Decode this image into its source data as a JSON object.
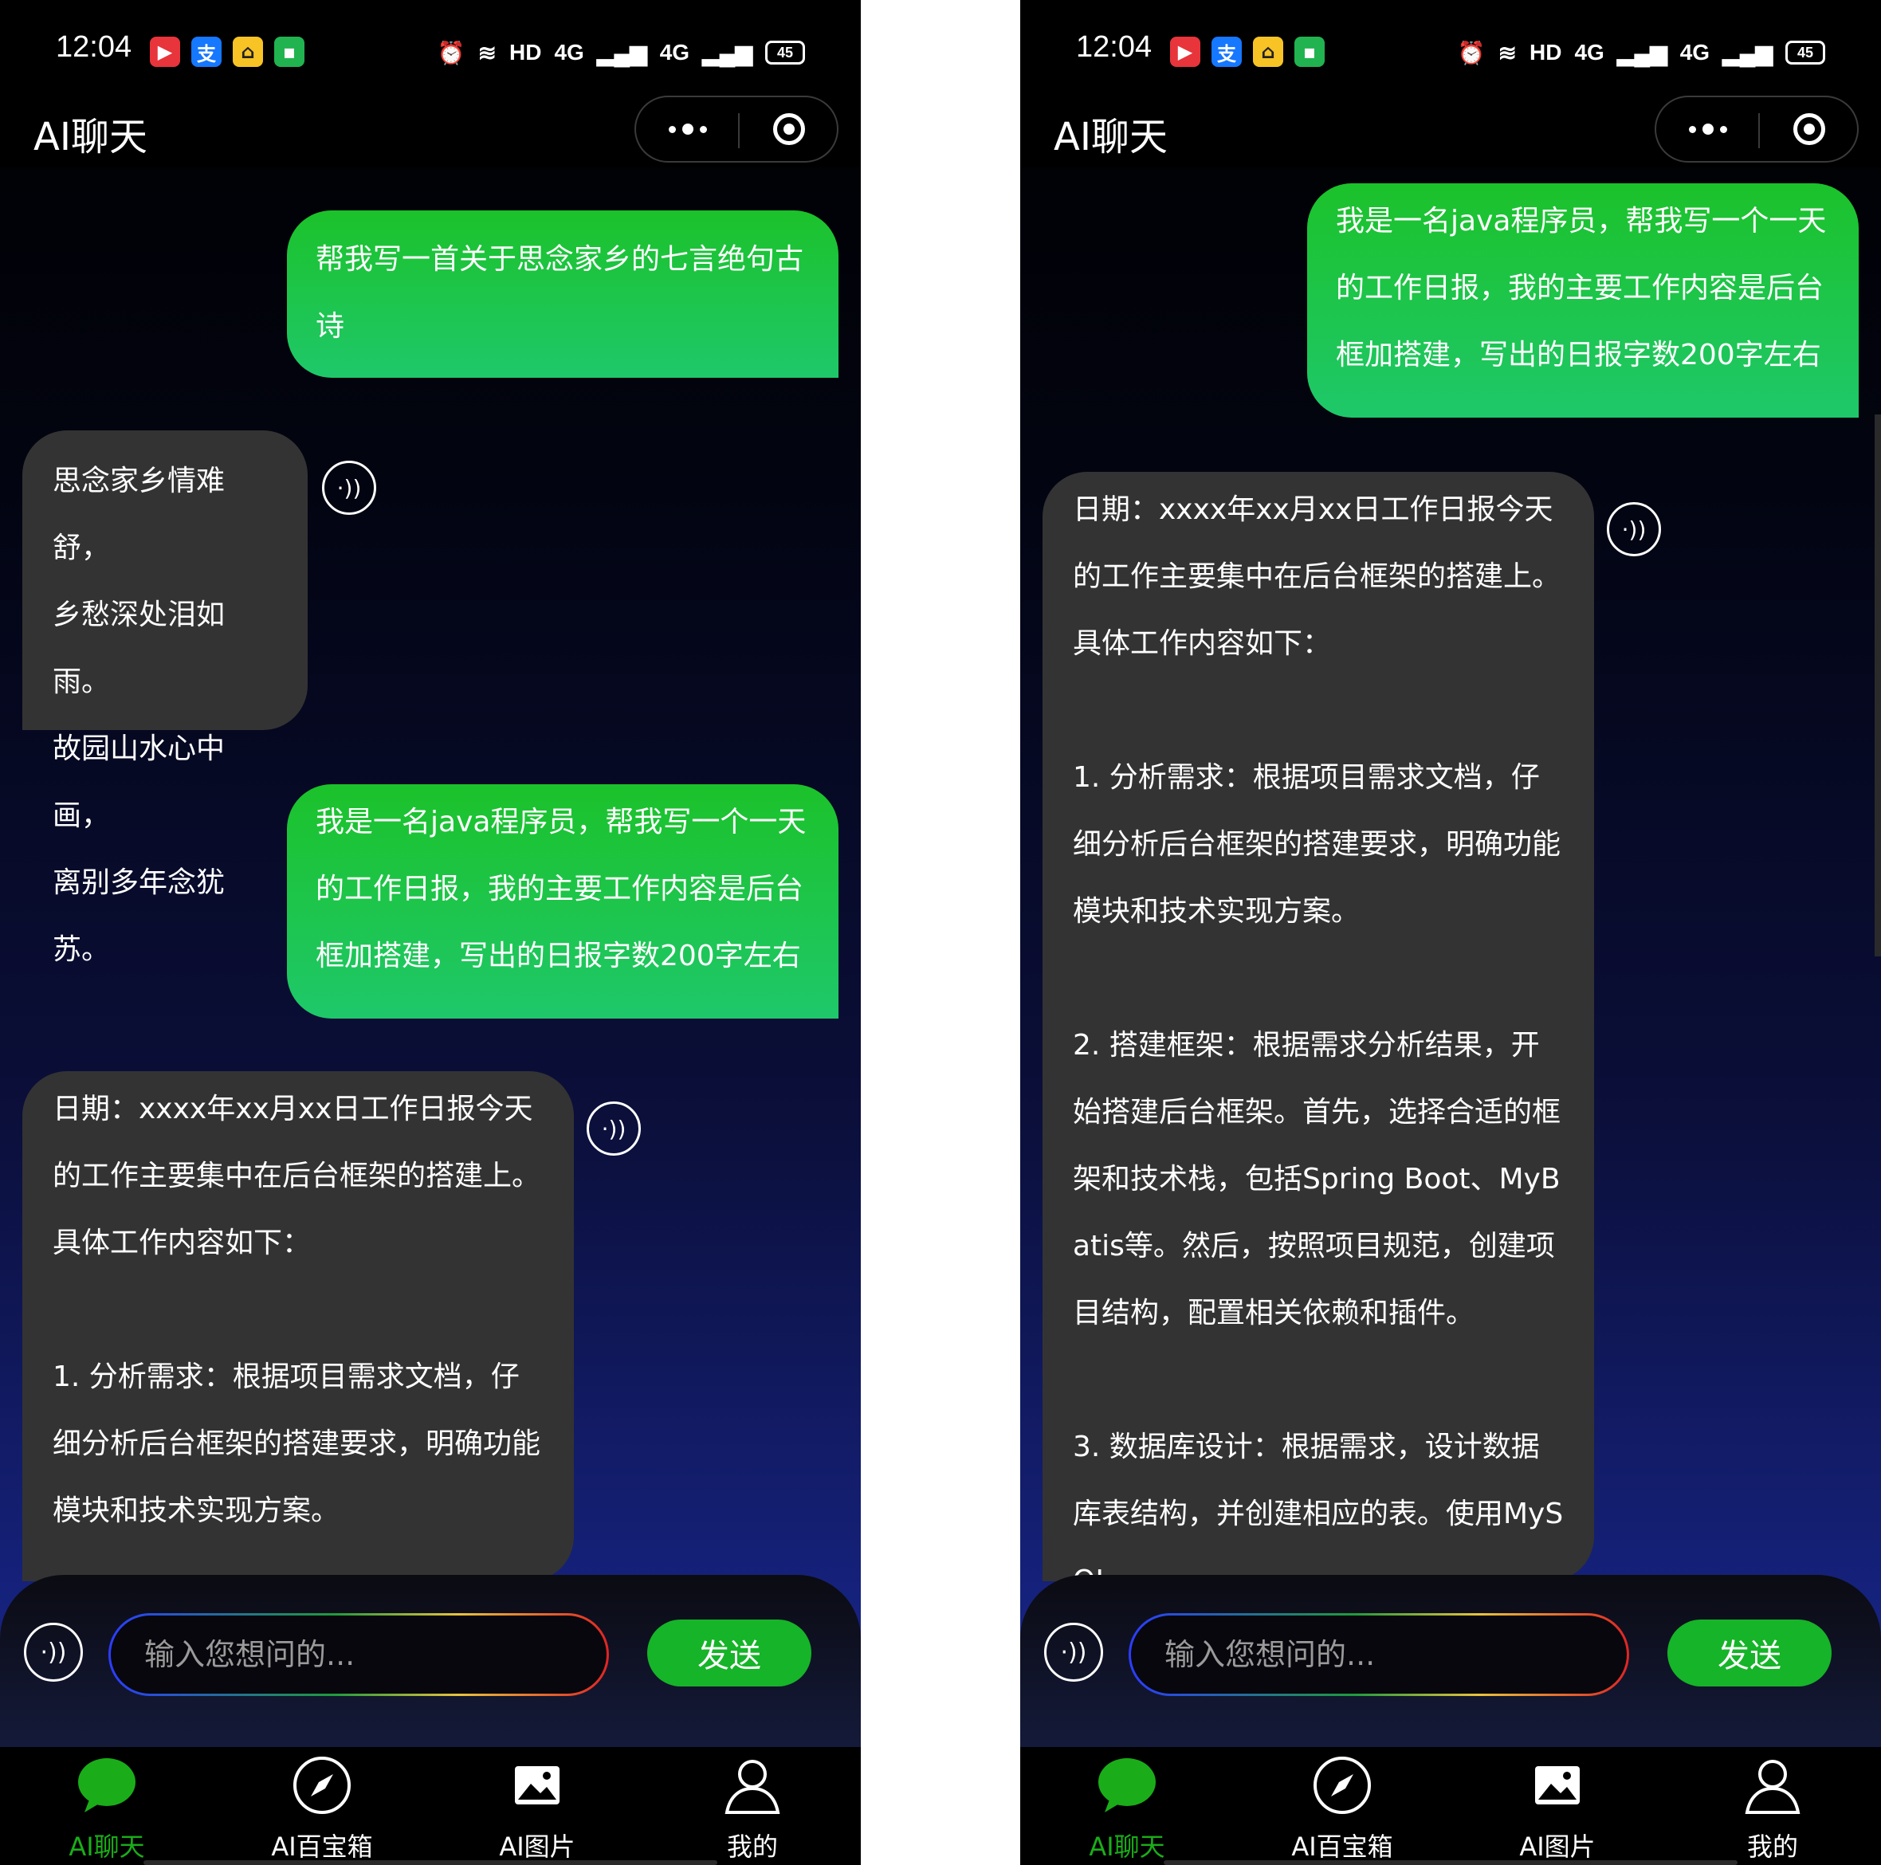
{
  "status_bar": {
    "time": "12:04",
    "app_icons": [
      "red-app-icon",
      "alipay-icon",
      "yellow-app-icon",
      "wechat-green-icon"
    ],
    "indicators": [
      "alarm-icon",
      "wifi-icon",
      "HD",
      "4G",
      "4G"
    ],
    "hd": "HD",
    "net1": "4G",
    "net2": "4G",
    "battery": "45"
  },
  "header": {
    "title": "AI聊天",
    "more_icon": "more-dots-icon",
    "target_icon": "target-icon"
  },
  "colors": {
    "user_bubble": "#1cc22a",
    "ai_bubble": "#333333",
    "accent_green": "#1aad19",
    "send_button": "#16b428"
  },
  "left_screen": {
    "messages": [
      {
        "role": "user",
        "text": "帮我写一首关于思念家乡的七言绝句古诗"
      },
      {
        "role": "ai",
        "text": "思念家乡情难舒，\n乡愁深处泪如雨。\n故园山水心中画，\n离别多年念犹苏。"
      },
      {
        "role": "user",
        "text": "我是一名java程序员，帮我写一个一天的工作日报，我的主要工作内容是后台框加搭建，写出的日报字数200字左右"
      },
      {
        "role": "ai",
        "text": "日期：xxxx年xx月xx日工作日报今天的工作主要集中在后台框架的搭建上。具体工作内容如下：\n\n1. 分析需求：根据项目需求文档，仔细分析后台框架的搭建要求，明确功能模块和技术实现方案。"
      }
    ]
  },
  "right_screen": {
    "messages": [
      {
        "role": "user",
        "text": "我是一名java程序员，帮我写一个一天的工作日报，我的主要工作内容是后台框加搭建，写出的日报字数200字左右"
      },
      {
        "role": "ai",
        "text": "日期：xxxx年xx月xx日工作日报今天的工作主要集中在后台框架的搭建上。具体工作内容如下：\n\n1. 分析需求：根据项目需求文档，仔细分析后台框架的搭建要求，明确功能模块和技术实现方案。\n\n2. 搭建框架：根据需求分析结果，开始搭建后台框架。首先，选择合适的框架和技术栈，包括Spring Boot、MyBatis等。然后，按照项目规范，创建项目结构，配置相关依赖和插件。\n\n3. 数据库设计：根据需求，设计数据库表结构，并创建相应的表。使用MySQL"
      }
    ]
  },
  "input_bar": {
    "mic_icon": "voice-icon",
    "placeholder": "输入您想问的...",
    "value": "",
    "send_label": "发送"
  },
  "tabbar": {
    "items": [
      {
        "label": "AI聊天",
        "icon": "chat-bubble-icon",
        "active": true
      },
      {
        "label": "AI百宝箱",
        "icon": "compass-icon",
        "active": false
      },
      {
        "label": "AI图片",
        "icon": "image-icon",
        "active": false
      },
      {
        "label": "我的",
        "icon": "user-icon",
        "active": false
      }
    ]
  }
}
